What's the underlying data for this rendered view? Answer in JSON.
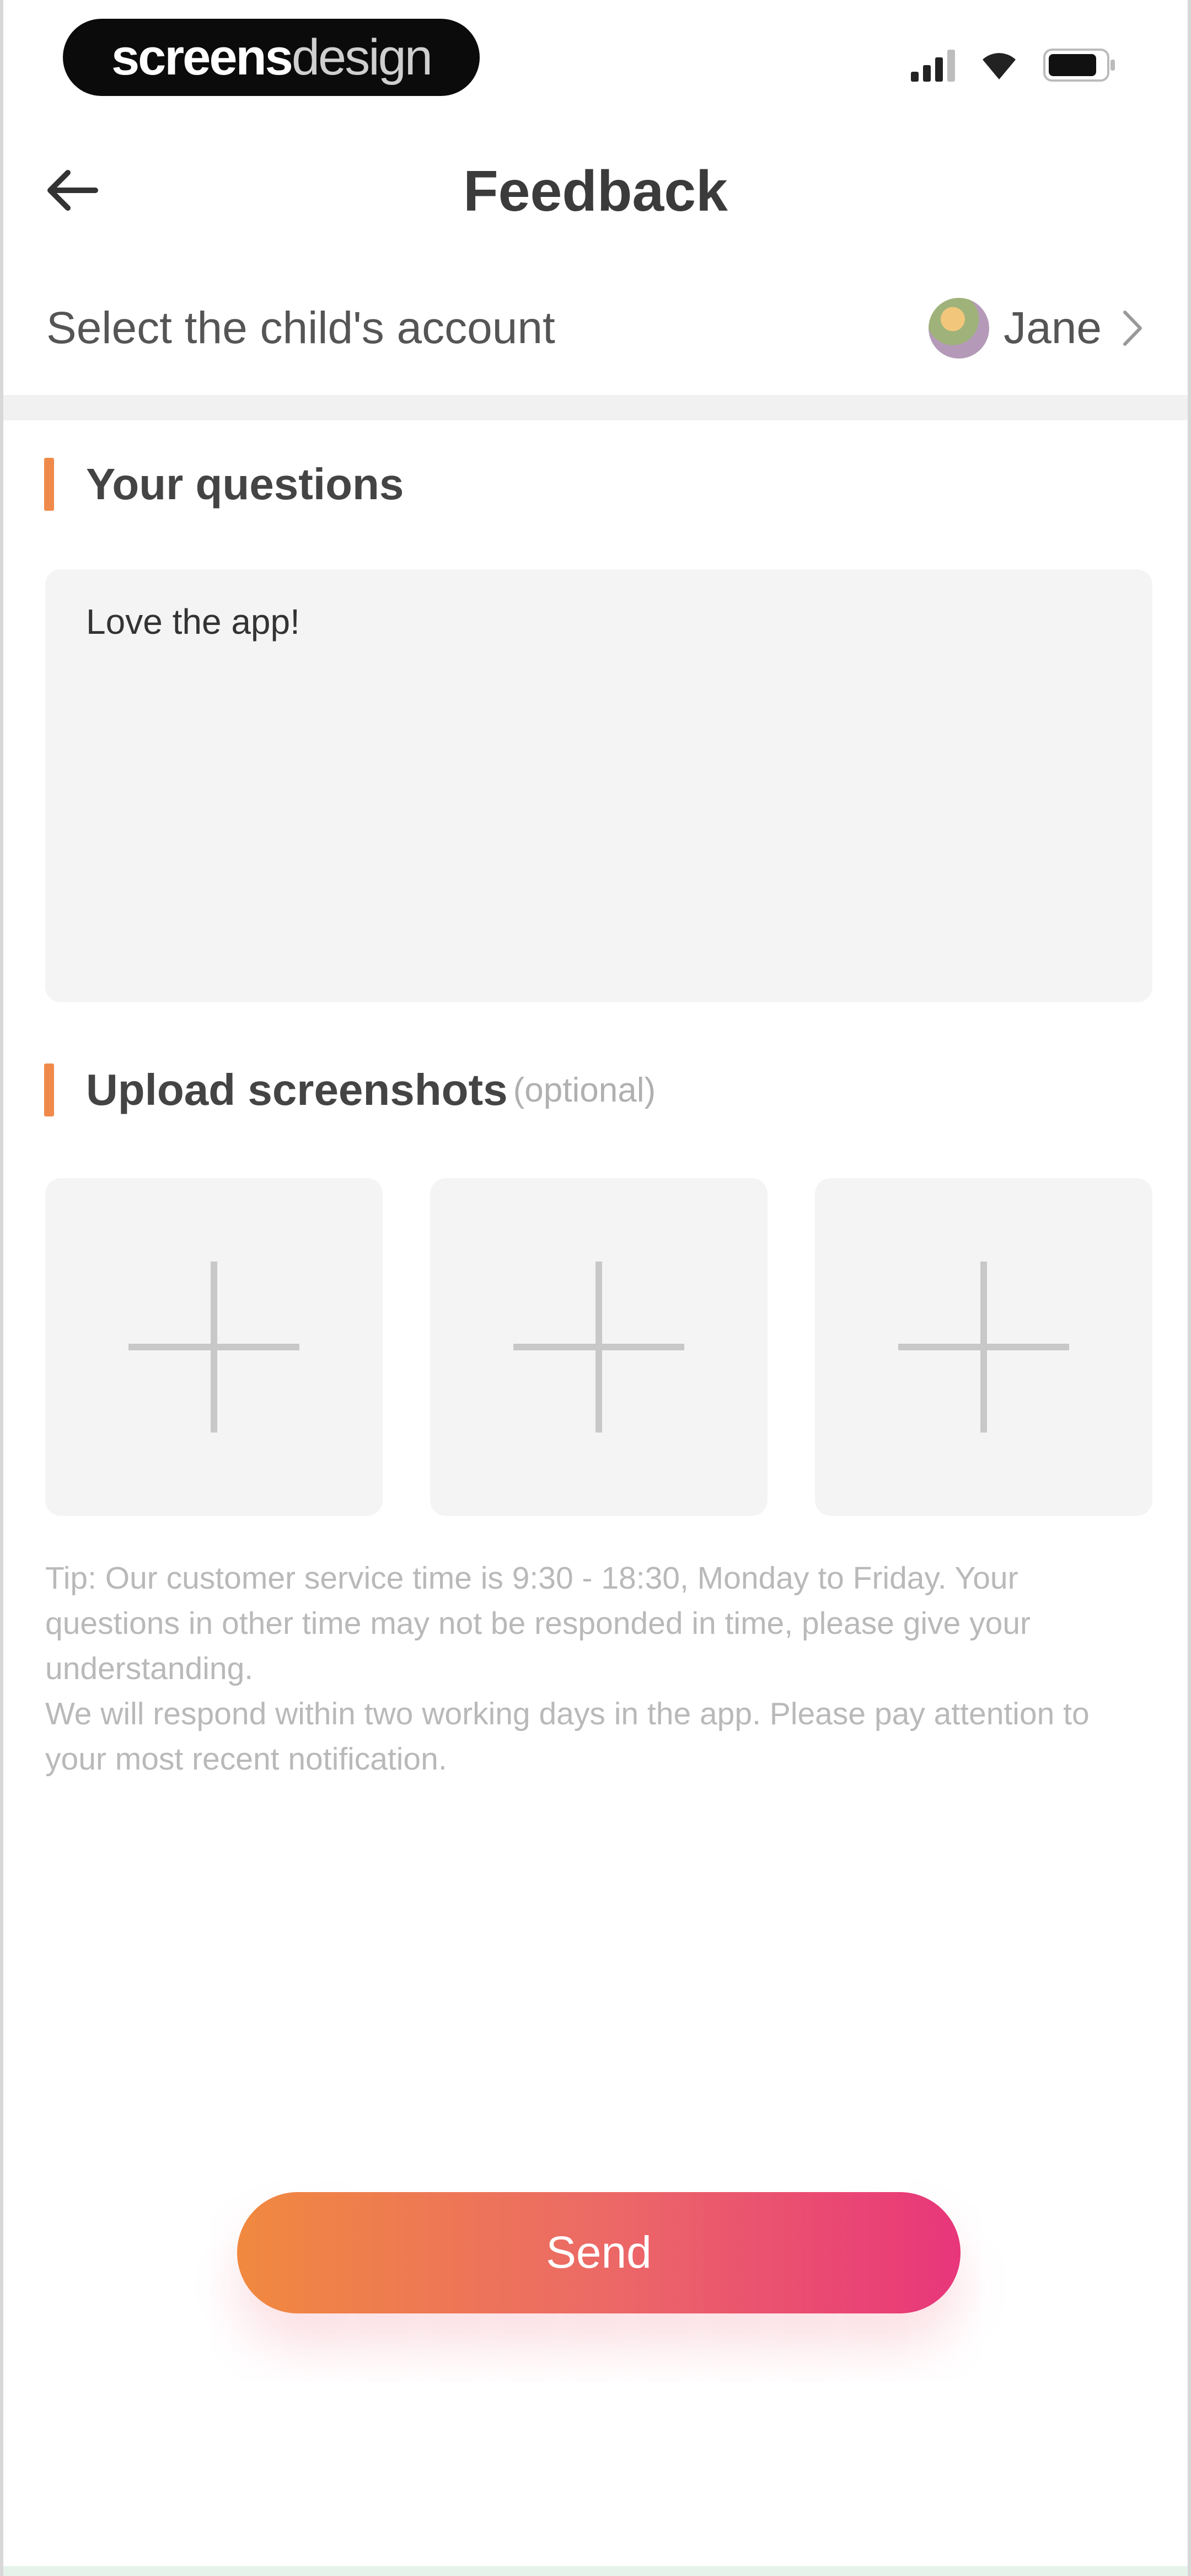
{
  "status_bar": {
    "brand_bold": "screens",
    "brand_light": "design"
  },
  "nav": {
    "title": "Feedback"
  },
  "account": {
    "label": "Select the child's account",
    "child_name": "Jane"
  },
  "questions": {
    "title": "Your questions",
    "text": "Love the app!"
  },
  "upload": {
    "title": "Upload screenshots",
    "optional_note": "(optional)",
    "tiles": 3
  },
  "tip": {
    "line1": "Tip: Our customer service time is 9:30 - 18:30, Monday to Friday. Your questions in other time may not be responded in time, please give your understanding.",
    "line2": "We will respond within two working days in the app. Please pay attention to your most recent notification."
  },
  "send_button": {
    "label": "Send"
  },
  "colors": {
    "accent": "#f08a4b",
    "gradient_start": "#f0893f",
    "gradient_end": "#e8367a"
  },
  "icons": {
    "back": "arrow-left-icon",
    "chevron": "chevron-right-icon",
    "add": "plus-icon"
  }
}
